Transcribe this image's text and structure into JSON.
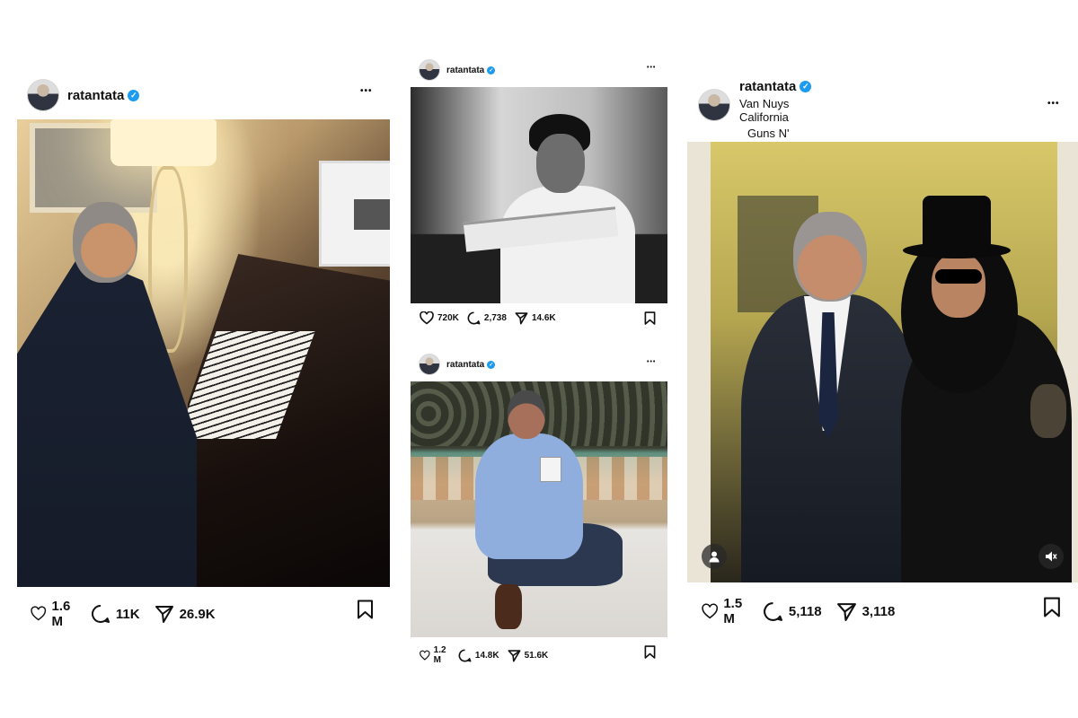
{
  "posts": [
    {
      "username": "ratantata",
      "likes": "1.6 M",
      "comments": "11K",
      "shares": "26.9K",
      "icons": {
        "like": "heart-icon",
        "comment": "comment-icon",
        "share": "send-icon",
        "save": "bookmark-icon",
        "verified": "verified-badge-icon",
        "more": "more-icon"
      }
    },
    {
      "username": "ratantata",
      "likes": "720K",
      "comments": "2,738",
      "shares": "14.6K"
    },
    {
      "username": "ratantata",
      "likes": "1.2 M",
      "comments": "14.8K",
      "shares": "51.6K"
    },
    {
      "username": "ratantata",
      "location": "Van Nuys California",
      "music": "Guns N' Roses · Sweet Child O' Mine",
      "likes": "1.5 M",
      "comments": "5,118",
      "shares": "3,118"
    }
  ],
  "more_glyph": "•••",
  "verified_glyph": "✓",
  "colors": {
    "verified": "#1d9bf0",
    "text": "#111111",
    "background": "#ffffff"
  }
}
